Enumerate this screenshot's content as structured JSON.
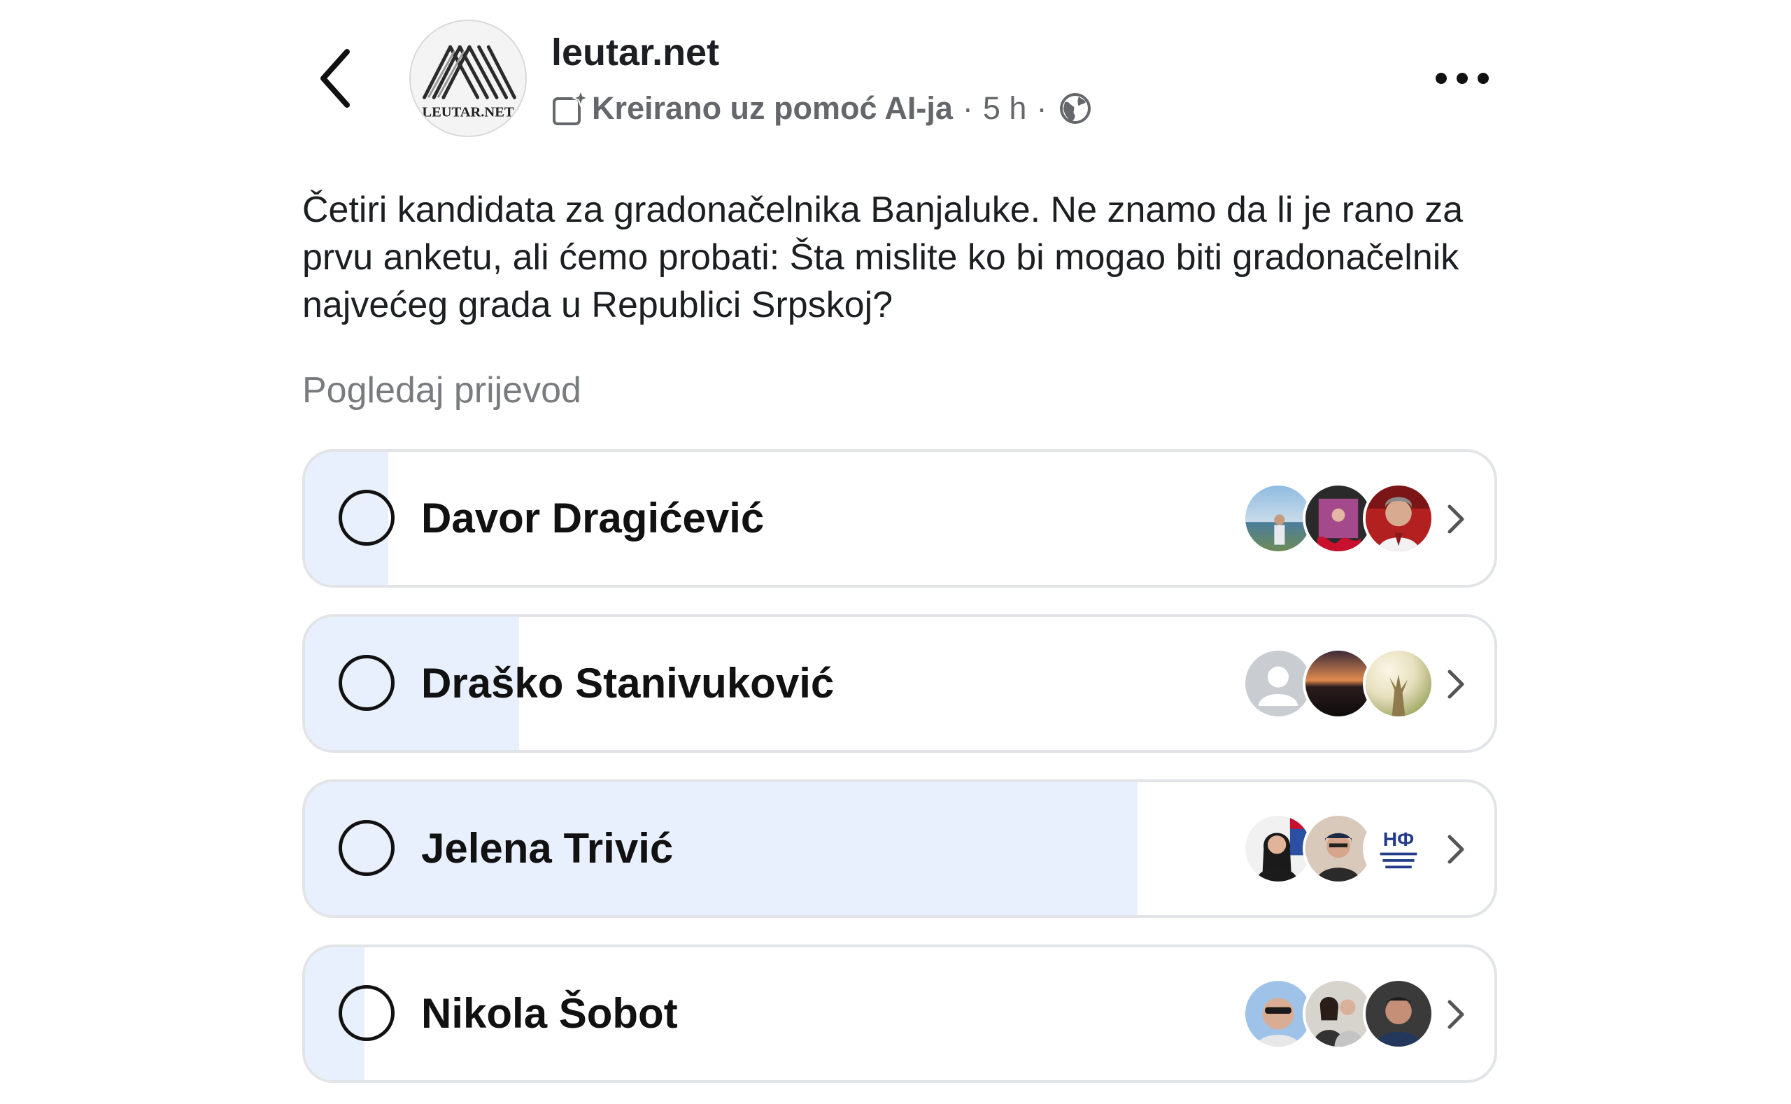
{
  "header": {
    "page_name": "leutar.net",
    "logo_text": "LEUTAR.NET",
    "ai_label": "Kreirano uz pomoć AI-ja",
    "separator": "·",
    "time": "5 h",
    "icons": {
      "back": "chevron-left-icon",
      "more": "more-horizontal-icon",
      "ai": "ai-sparkle-icon",
      "audience": "globe-icon"
    }
  },
  "post": {
    "text": "Četiri kandidata za gradonačelnika Banjaluke. Ne znamo da li je rano za prvu anketu, ali ćemo probati: Šta mislite ko bi mogao biti gradonačelnik najvećeg grada u Republici Srpskoj?",
    "translate_link": "Pogledaj prijevod"
  },
  "poll": {
    "fill_color": "#e8f0fd",
    "options": [
      {
        "label": "Davor Dragićević",
        "fill_fraction": 0.07
      },
      {
        "label": "Draško Stanivuković",
        "fill_fraction": 0.18
      },
      {
        "label": "Jelena Trivić",
        "fill_fraction": 0.7
      },
      {
        "label": "Nikola Šobot",
        "fill_fraction": 0.05
      }
    ],
    "voter_badge_text": "НФ"
  }
}
